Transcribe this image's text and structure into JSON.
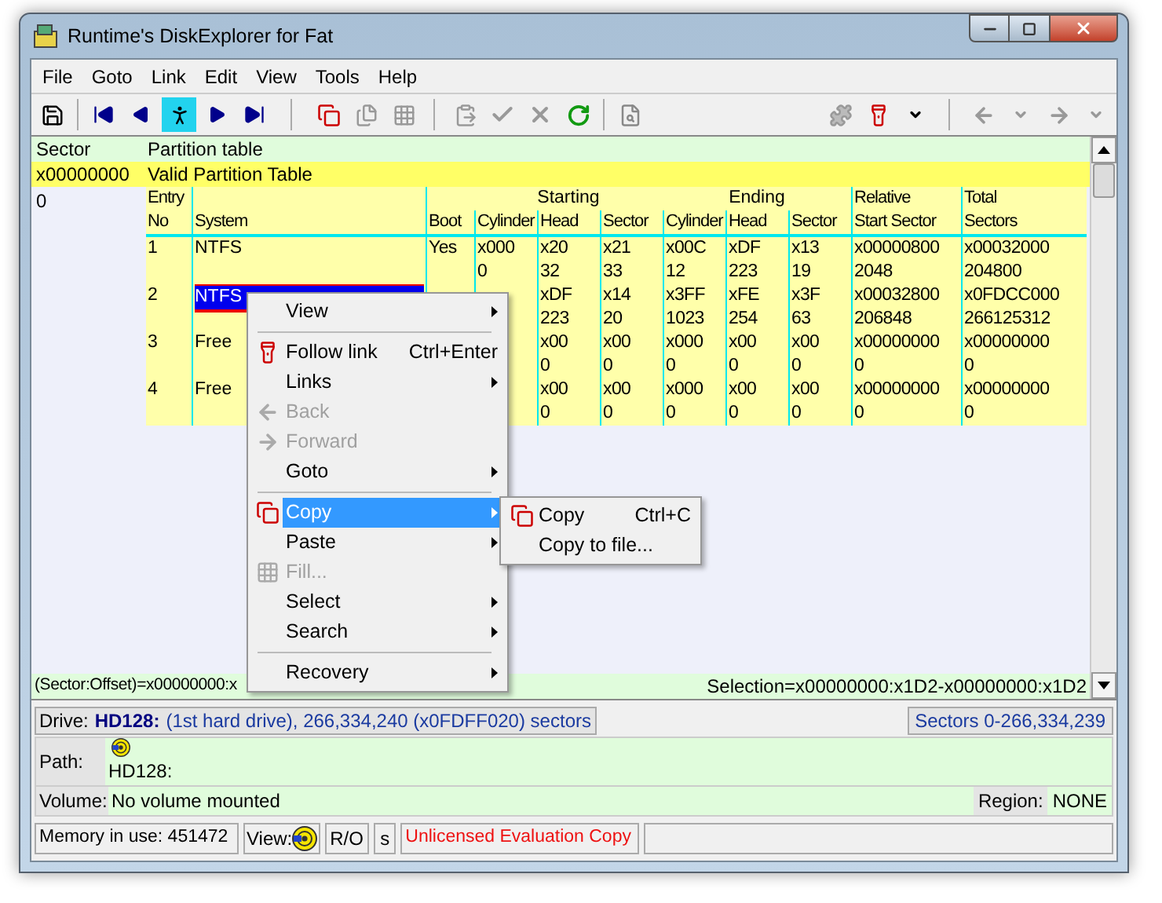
{
  "window": {
    "title": "Runtime's DiskExplorer for Fat"
  },
  "menu_bar": [
    "File",
    "Goto",
    "Link",
    "Edit",
    "View",
    "Tools",
    "Help"
  ],
  "list_header": {
    "sector": "Sector",
    "description": "Partition table"
  },
  "list_row": {
    "sector": "x00000000",
    "description": "Valid Partition Table"
  },
  "sector_value": "0",
  "table": {
    "header_groups": [
      {
        "columns": [
          "Entry\nNo",
          "System",
          "Boot"
        ]
      },
      {
        "label": "Starting",
        "columns": [
          "Cylinder",
          "Head",
          "Sector"
        ]
      },
      {
        "label": "Ending",
        "columns": [
          "Cylinder",
          "Head",
          "Sector"
        ]
      },
      {
        "columns": [
          "Relative\nStart Sector",
          "Total\nSectors"
        ]
      }
    ],
    "rows": [
      {
        "entry": "1",
        "system": {
          "text": "NTFS",
          "selected": false
        },
        "cells": [
          "Yes",
          "x000\n0",
          "x20\n32",
          "x21\n33",
          "x00C\n12",
          "xDF\n223",
          "x13\n19",
          "x00000800\n2048",
          "x00032000\n204800"
        ]
      },
      {
        "entry": "2",
        "system": {
          "text": "NTFS",
          "selected": true
        },
        "cells": [
          null,
          null,
          "xDF\n223",
          "x14\n20",
          "x3FF\n1023",
          "xFE\n254",
          "x3F\n63",
          "x00032800\n206848",
          "x0FDCC000\n266125312"
        ]
      },
      {
        "entry": "3",
        "system": {
          "text": "Free",
          "selected": false
        },
        "cells": [
          null,
          null,
          "x00\n0",
          "x00\n0",
          "x000\n0",
          "x00\n0",
          "x00\n0",
          "x00000000\n0",
          "x00000000\n0"
        ]
      },
      {
        "entry": "4",
        "system": {
          "text": "Free",
          "selected": false
        },
        "cells": [
          null,
          null,
          "x00\n0",
          "x00\n0",
          "x000\n0",
          "x00\n0",
          "x00\n0",
          "x00000000\n0",
          "x00000000\n0"
        ]
      }
    ]
  },
  "context_menu": [
    {
      "kind": "item",
      "label": "View",
      "submenu": true,
      "disabled": false,
      "selected": false
    },
    {
      "kind": "separator"
    },
    {
      "kind": "item",
      "label": "Follow link",
      "shortcut": "Ctrl+Enter",
      "submenu": false,
      "disabled": false,
      "selected": false
    },
    {
      "kind": "item",
      "label": "Links",
      "submenu": true,
      "disabled": false,
      "selected": false
    },
    {
      "kind": "item",
      "label": "Back",
      "submenu": false,
      "disabled": true,
      "selected": false
    },
    {
      "kind": "item",
      "label": "Forward",
      "submenu": false,
      "disabled": true,
      "selected": false
    },
    {
      "kind": "item",
      "label": "Goto",
      "submenu": true,
      "disabled": false,
      "selected": false
    },
    {
      "kind": "separator"
    },
    {
      "kind": "item",
      "label": "Copy",
      "submenu": true,
      "disabled": false,
      "selected": true
    },
    {
      "kind": "item",
      "label": "Paste",
      "submenu": true,
      "disabled": false,
      "selected": false
    },
    {
      "kind": "item",
      "label": "Fill...",
      "submenu": false,
      "disabled": true,
      "selected": false
    },
    {
      "kind": "item",
      "label": "Select",
      "submenu": true,
      "disabled": false,
      "selected": false
    },
    {
      "kind": "item",
      "label": "Search",
      "submenu": true,
      "disabled": false,
      "selected": false
    },
    {
      "kind": "separator"
    },
    {
      "kind": "item",
      "label": "Recovery",
      "submenu": true,
      "disabled": false,
      "selected": false
    }
  ],
  "submenu": [
    {
      "label": "Copy",
      "shortcut": "Ctrl+C"
    },
    {
      "label": "Copy to file..."
    }
  ],
  "offset_line": {
    "position": "(Sector:Offset)=x00000000:x",
    "selection": "Selection=x00000000:x1D2-x00000000:x1D2"
  },
  "drive_bar": {
    "label": "Drive:",
    "drive": "HD128:",
    "description": "(1st hard drive), 266,334,240 (x0FDFF020) sectors",
    "range": "Sectors 0-266,334,239"
  },
  "path": {
    "label": "Path:",
    "value": "HD128:"
  },
  "volume": {
    "label": "Volume:",
    "value": "No volume mounted",
    "region_label": "Region:",
    "region": "NONE"
  },
  "status_bar": {
    "memory": "Memory in use: 451472",
    "view_label": "View:",
    "mode": "R/O",
    "flag": "s",
    "license": "Unlicensed Evaluation Copy"
  }
}
